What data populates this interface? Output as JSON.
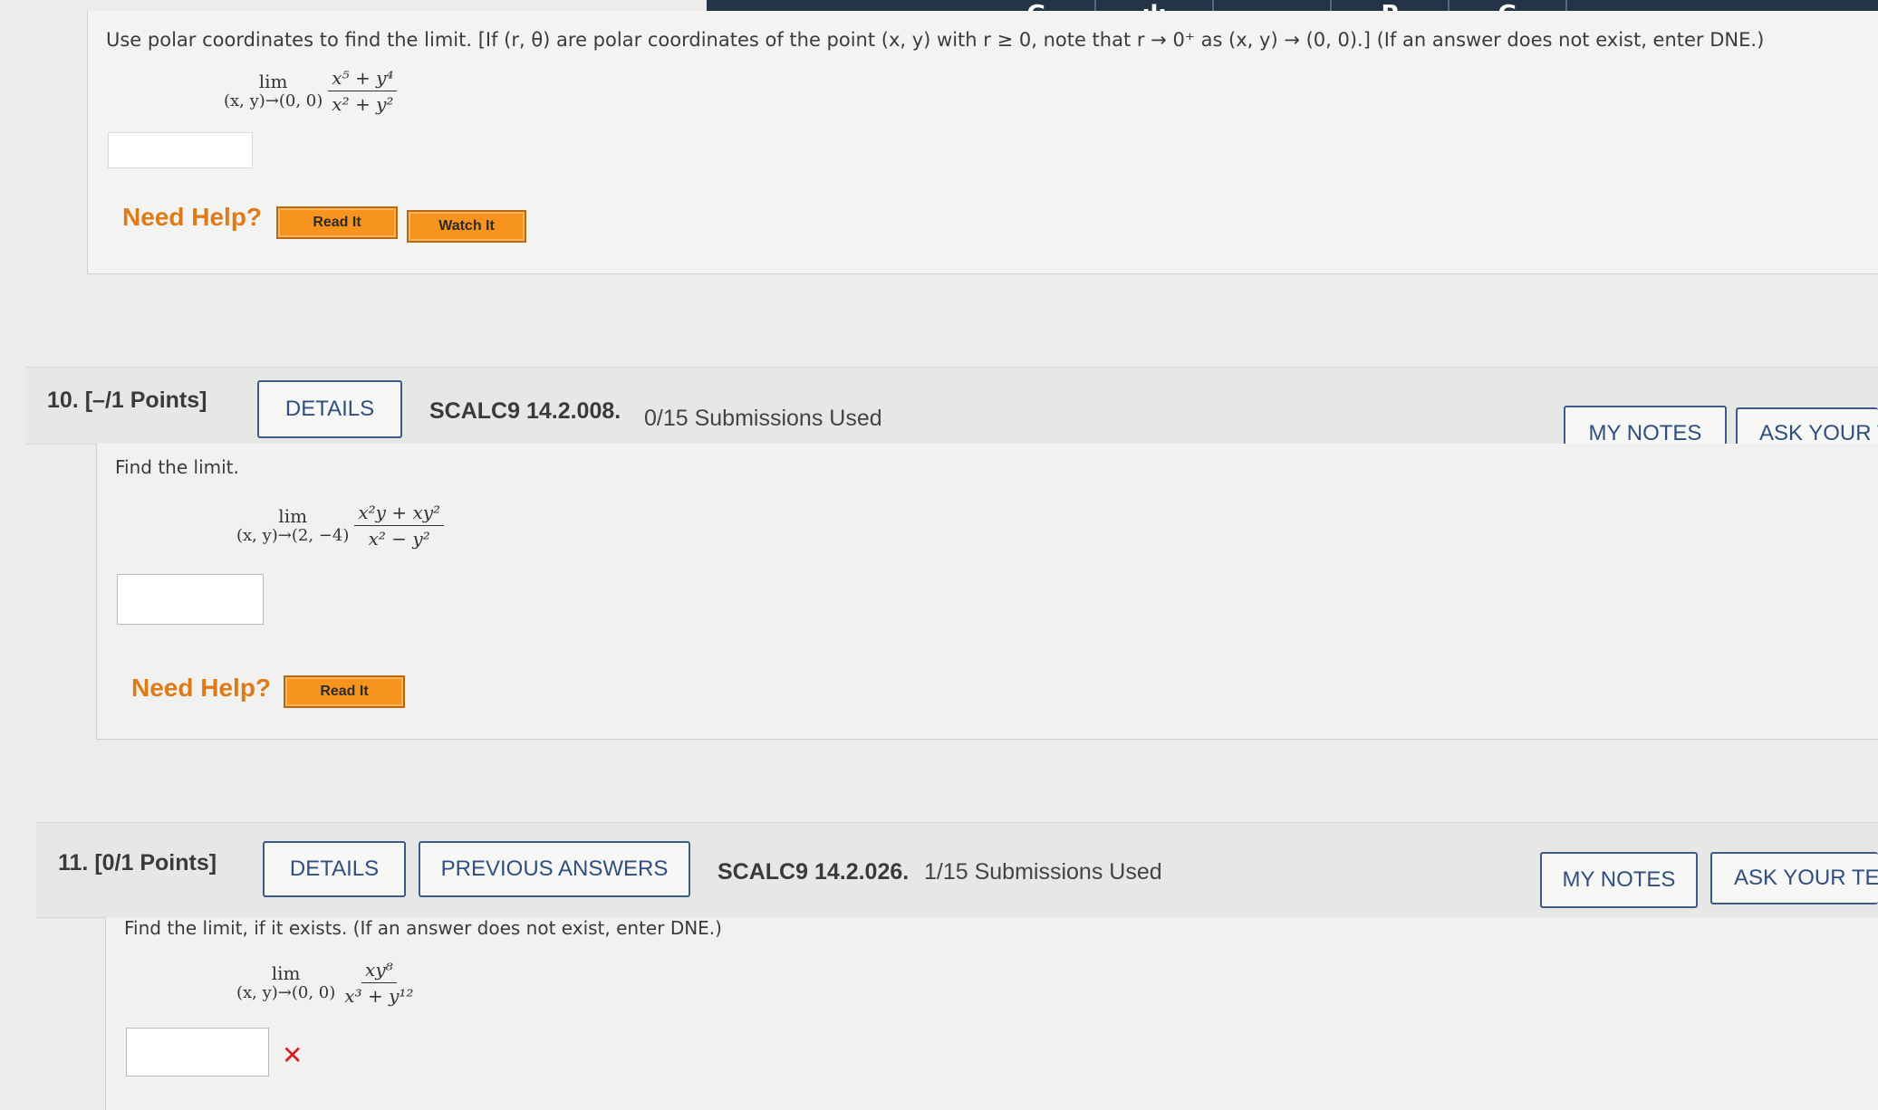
{
  "toolbar": {
    "tabs": [
      {
        "icon": "grammarly-icon",
        "glyph": "G"
      },
      {
        "icon": "bars-icon",
        "glyph": "ılı"
      },
      {
        "icon": "doc-icon",
        "glyph": "▬"
      },
      {
        "icon": "p-icon",
        "glyph": "P"
      },
      {
        "icon": "google-icon",
        "glyph": "G"
      }
    ]
  },
  "q9": {
    "prompt": "Use polar coordinates to find the limit. [If (r, θ) are polar coordinates of the point (x, y) with r ≥ 0, note that r → 0⁺ as (x, y) → (0, 0).] (If an answer does not exist, enter DNE.)",
    "lim_word": "lim",
    "lim_sub": "(x, y)→(0, 0)",
    "numerator": "x⁵ + y⁴",
    "denominator": "x² + y²",
    "need_help": "Need Help?",
    "read_it": "Read It",
    "watch_it": "Watch It"
  },
  "q10": {
    "number": "10.",
    "points": "[–/1 Points]",
    "details": "DETAILS",
    "code": "SCALC9 14.2.008.",
    "submissions": "0/15 Submissions Used",
    "my_notes": "MY NOTES",
    "ask": "ASK YOUR T",
    "prompt": "Find the limit.",
    "lim_word": "lim",
    "lim_sub": "(x, y)→(2, −4)",
    "numerator": "x²y + xy²",
    "denominator": "x² − y²",
    "need_help": "Need Help?",
    "read_it": "Read It"
  },
  "q11": {
    "number": "11.",
    "points": "[0/1 Points]",
    "details": "DETAILS",
    "previous_answers": "PREVIOUS ANSWERS",
    "code": "SCALC9 14.2.026.",
    "submissions": "1/15 Submissions Used",
    "my_notes": "MY NOTES",
    "ask": "ASK YOUR TE",
    "prompt": "Find the limit, if it exists. (If an answer does not exist, enter DNE.)",
    "lim_word": "lim",
    "lim_sub": "(x, y)→(0, 0)",
    "numerator": "xy⁸",
    "denominator": "x³ + y¹²",
    "incorrect_mark": "✕"
  }
}
